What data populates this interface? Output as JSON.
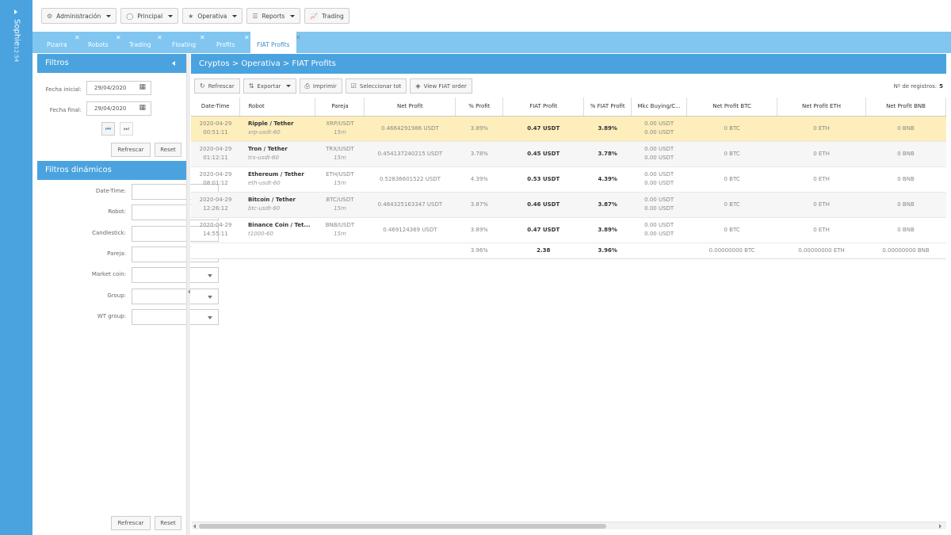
{
  "user": {
    "name": "Sophie",
    "sub": "12:54"
  },
  "topmenu": [
    {
      "label": "Administración",
      "icon": "gear-icon",
      "glyph": "⚙",
      "dropdown": true
    },
    {
      "label": "Principal",
      "icon": "circle-gear-icon",
      "glyph": "◯",
      "dropdown": true
    },
    {
      "label": "Operativa",
      "icon": "star-icon",
      "glyph": "★",
      "dropdown": true
    },
    {
      "label": "Reports",
      "icon": "list-icon",
      "glyph": "☰",
      "dropdown": true
    },
    {
      "label": "Trading",
      "icon": "chart-line-icon",
      "glyph": "📈",
      "dropdown": false
    }
  ],
  "tabs": [
    {
      "label": "Pizarra",
      "active": false
    },
    {
      "label": "Robots",
      "active": false
    },
    {
      "label": "Trading",
      "active": false
    },
    {
      "label": "Floating",
      "active": false
    },
    {
      "label": "Profits",
      "active": false
    },
    {
      "label": "FIAT Profits",
      "active": true
    }
  ],
  "filters": {
    "title": "Filtros",
    "start_label": "Fecha inicial:",
    "start_value": "29/04/2020",
    "end_label": "Fecha final:",
    "end_value": "29/04/2020",
    "refresh": "Refrescar",
    "reset": "Reset"
  },
  "dynamic_filters": {
    "title": "Filtros dinámicos",
    "fields": [
      {
        "label": "Date-Time:",
        "type": "text"
      },
      {
        "label": "Robot:",
        "type": "text"
      },
      {
        "label": "Candlestick:",
        "type": "text"
      },
      {
        "label": "Pareja:",
        "type": "text"
      },
      {
        "label": "Market coin:",
        "type": "select"
      },
      {
        "label": "Group:",
        "type": "select"
      },
      {
        "label": "WT group:",
        "type": "select"
      }
    ],
    "refresh": "Refrescar",
    "reset": "Reset"
  },
  "main": {
    "breadcrumb": "Cryptos > Operativa > FIAT Profits",
    "toolbar": [
      {
        "label": "Refrescar",
        "icon": "refresh-icon",
        "glyph": "↻",
        "dropdown": false
      },
      {
        "label": "Exportar",
        "icon": "export-icon",
        "glyph": "⇅",
        "dropdown": true
      },
      {
        "label": "Imprimir",
        "icon": "print-icon",
        "glyph": "⎙",
        "dropdown": false
      },
      {
        "label": "Seleccionar tot",
        "icon": "checkbox-icon",
        "glyph": "☑",
        "dropdown": false
      },
      {
        "label": "View FIAT order",
        "icon": "tag-icon",
        "glyph": "◈",
        "dropdown": false
      }
    ],
    "records_label": "Nº de registros:",
    "records_count": "5"
  },
  "table": {
    "columns": [
      "Date-Time",
      "Robot",
      "Pareja",
      "Net Profit",
      "% Profit",
      "FIAT Profit",
      "% FIAT Profit",
      "Mkc Buying/C...",
      "Net Profit BTC",
      "Net Profit ETH",
      "Net Profit BNB"
    ],
    "rows": [
      {
        "date": "2020-04-29",
        "time": "00:51:11",
        "robot": "Ripple / Tether",
        "robot_code": "xrp-usdt-60",
        "pair": "XRP/USDT",
        "pair_tf": "15m",
        "net_profit": "0.4664291986 USDT",
        "pct_profit": "3.89%",
        "fiat_profit": "0.47 USDT",
        "pct_fiat": "3.89%",
        "mkc1": "0.00 USDT",
        "mkc2": "0.00 USDT",
        "btc": "0 BTC",
        "eth": "0 ETH",
        "bnb": "0 BNB"
      },
      {
        "date": "2020-04-29",
        "time": "01:12:11",
        "robot": "Tron / Tether",
        "robot_code": "trx-usdt-60",
        "pair": "TRX/USDT",
        "pair_tf": "15m",
        "net_profit": "0.454137240215 USDT",
        "pct_profit": "3.78%",
        "fiat_profit": "0.45 USDT",
        "pct_fiat": "3.78%",
        "mkc1": "0.00 USDT",
        "mkc2": "0.00 USDT",
        "btc": "0 BTC",
        "eth": "0 ETH",
        "bnb": "0 BNB"
      },
      {
        "date": "2020-04-29",
        "time": "08:01:12",
        "robot": "Ethereum / Tether",
        "robot_code": "eth-usdt-60",
        "pair": "ETH/USDT",
        "pair_tf": "15m",
        "net_profit": "0.52836601522 USDT",
        "pct_profit": "4.39%",
        "fiat_profit": "0.53 USDT",
        "pct_fiat": "4.39%",
        "mkc1": "0.00 USDT",
        "mkc2": "0.00 USDT",
        "btc": "0 BTC",
        "eth": "0 ETH",
        "bnb": "0 BNB"
      },
      {
        "date": "2020-04-29",
        "time": "12:26:12",
        "robot": "Bitcoin / Tether",
        "robot_code": "btc-usdt-60",
        "pair": "BTC/USDT",
        "pair_tf": "15m",
        "net_profit": "0.464325163347 USDT",
        "pct_profit": "3.87%",
        "fiat_profit": "0.46 USDT",
        "pct_fiat": "3.87%",
        "mkc1": "0.00 USDT",
        "mkc2": "0.00 USDT",
        "btc": "0 BTC",
        "eth": "0 ETH",
        "bnb": "0 BNB"
      },
      {
        "date": "2020-04-29",
        "time": "14:55:11",
        "robot": "Binance Coin / Tet...",
        "robot_code": "t1000-60",
        "pair": "BNB/USDT",
        "pair_tf": "15m",
        "net_profit": "0.469124369 USDT",
        "pct_profit": "3.89%",
        "fiat_profit": "0.47 USDT",
        "pct_fiat": "3.89%",
        "mkc1": "0.00 USDT",
        "mkc2": "0.00 USDT",
        "btc": "0 BTC",
        "eth": "0 ETH",
        "bnb": "0 BNB"
      }
    ],
    "totals": {
      "pct_profit": "3.96%",
      "fiat_profit": "2.38",
      "pct_fiat": "3.96%",
      "btc": "0.00000000 BTC",
      "eth": "0.00000000 ETH",
      "bnb": "0.00000000 BNB"
    }
  },
  "colors": {
    "sidebar": "#4aa3df",
    "tabbar": "#80c6f0",
    "selected_row": "#fdeebb"
  }
}
